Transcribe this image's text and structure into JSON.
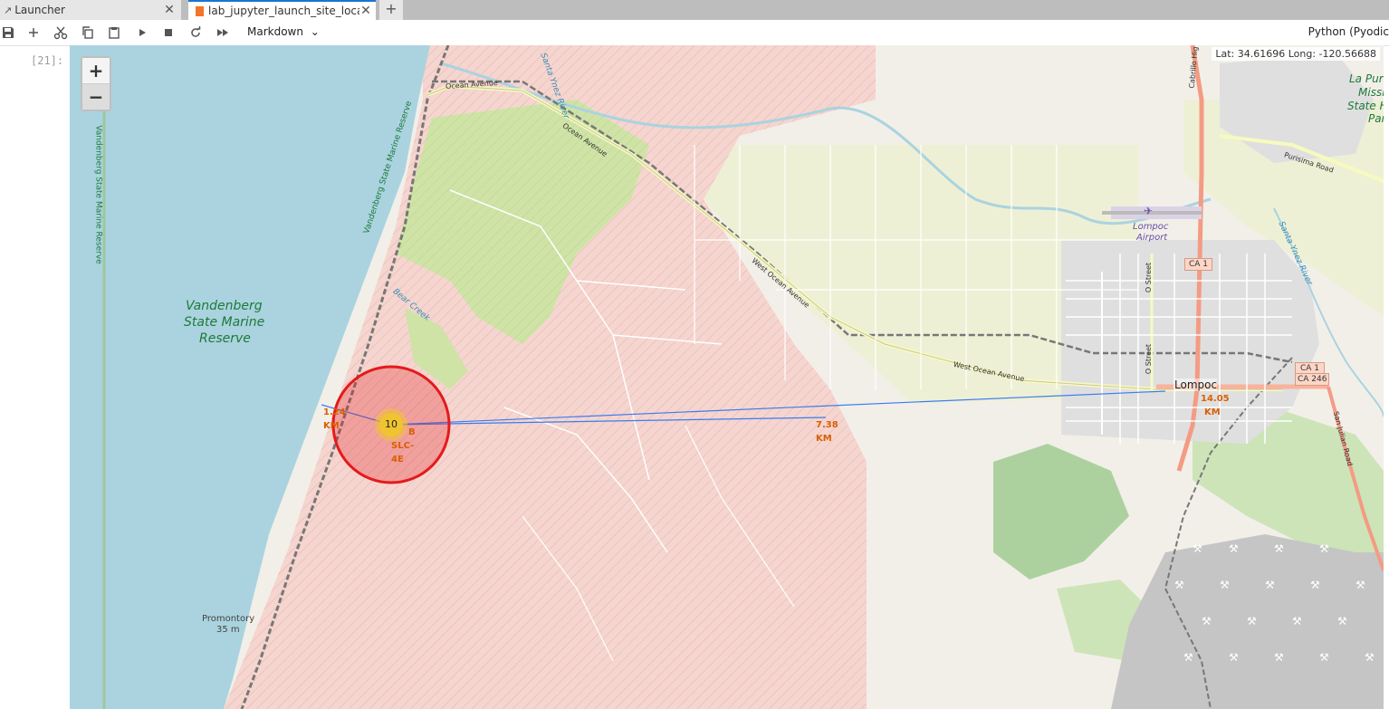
{
  "tabs": [
    {
      "label": "Launcher",
      "active": false
    },
    {
      "label": "lab_jupyter_launch_site_locat",
      "active": true
    }
  ],
  "toolbar": {
    "cell_type": "Markdown",
    "kernel": "Python (Pyodic",
    "icons": [
      "save-icon",
      "add-cell-icon",
      "cut-icon",
      "copy-icon",
      "paste-icon",
      "run-icon",
      "stop-icon",
      "restart-icon",
      "run-all-icon"
    ]
  },
  "cell": {
    "prompt": "[21]:"
  },
  "map": {
    "zoom_in": "+",
    "zoom_out": "−",
    "mouse_position": "Lat: 34.61696 Long: -120.56688",
    "place_labels": {
      "reserve_1": "Vandenberg",
      "reserve_2": "State Marine",
      "reserve_3": "Reserve",
      "reserve_vertical_1": "Vandenberg State Marine Reserve",
      "reserve_vertical_2": "Vandenberg State Marine Reserve",
      "promontory": "Promontory",
      "promontory_elev": "35 m",
      "lompoc": "Lompoc",
      "airport_1": "Lompoc",
      "airport_2": "Airport",
      "ocean_avenue_1": "Ocean Avenue",
      "ocean_avenue_2": "Ocean Avenue",
      "west_ocean_avenue_1": "West Ocean Avenue",
      "west_ocean_avenue_2": "West Ocean Avenue",
      "purisima_road": "Purisima Road",
      "o_street_1": "O Street",
      "o_street_2": "O Street",
      "ca1_top": "CA 1",
      "ca1_mid": "CA 1",
      "ca246": "CA 246",
      "la_purisima_1": "La Puri",
      "la_purisima_2": "Missi",
      "la_purisima_3": "State H",
      "la_purisima_4": "Par",
      "bear_creek": "Bear Creek",
      "santa_ynez_river": "Santa Ynez River",
      "santa_ynez_river_2": "Santa Ynez River",
      "cabrillo_hwy": "Cabrillo Hig",
      "san_julian": "San Julian Road"
    },
    "cluster_count": "10",
    "site_label": [
      "B",
      "SLC-",
      "4E"
    ],
    "distances": [
      {
        "value": "1.24",
        "unit": "KM"
      },
      {
        "value": "7.38",
        "unit": "KM"
      },
      {
        "value": "14.05",
        "unit": "KM"
      }
    ],
    "colors": {
      "ocean": "#aad3df",
      "military": "#f5d5cf",
      "park": "#cfe3a7",
      "residential": "#e0dfdf",
      "farmland": "#eef0d5",
      "circle": "#e31a1c",
      "line": "#3a7cf2",
      "distance_text": "#d95f02",
      "motorway": "#f49b84"
    }
  }
}
